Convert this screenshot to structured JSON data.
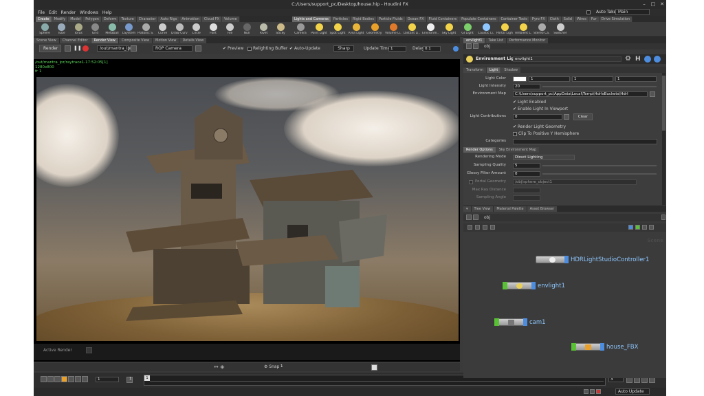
{
  "window": {
    "title": "C:/Users/support_pc/Desktop/house.hip - Houdini FX"
  },
  "menu": [
    "File",
    "Edit",
    "Render",
    "Windows",
    "Help"
  ],
  "takes": {
    "label": "Auto Takes",
    "desktop": "Main"
  },
  "shelf_tabs_left": [
    "Create",
    "Modify",
    "Model",
    "Polygon",
    "Deform",
    "Texture",
    "Character",
    "Auto Rigs",
    "Animation",
    "Cloud FX",
    "Volume"
  ],
  "shelf_tabs_right": [
    "Lights and Cameras",
    "Particles",
    "Rigid Bodies",
    "Particle Fluids",
    "Ocean FX",
    "Fluid Containers",
    "Populate Containers",
    "Container Tools",
    "Pyro FX",
    "Cloth",
    "Solid",
    "Wires",
    "Fur",
    "Drive Simulation"
  ],
  "tools_left": [
    "Sphere",
    "Tube",
    "Torus",
    "Grid",
    "Metaball",
    "LSystem",
    "Platonic S...",
    "Curve",
    "Draw Curve",
    "Circle",
    "Font",
    "File",
    "Null",
    "Rivet",
    "Sticky"
  ],
  "tools_right": [
    "Camera",
    "Point Light",
    "Spot Light",
    "Area Light",
    "Geometry ...",
    "Volume Li...",
    "Distant Li...",
    "Environm...",
    "Sky Light",
    "GI Light",
    "Caustic Li...",
    "Portal Light",
    "Ambient L...",
    "Stereo Ca...",
    "Switcher"
  ],
  "left_panel_tabs": [
    "Scene View",
    "Channel Editor",
    "Render View",
    "Composite View",
    "Motion View",
    "Details View"
  ],
  "right_panel_tabs": [
    "envlight1",
    "Take List",
    "Performance Monitor"
  ],
  "render_toolbar": {
    "render_label": "Render",
    "output": "/out/mantra_ipr",
    "camera": "ROP Camera",
    "preview": "Preview",
    "relighting": "Relighting Buffer",
    "auto_update": "Auto-Update",
    "sharp": "Sharp",
    "update_time_label": "Update Time",
    "update_time": "1",
    "delay_label": "Delay",
    "delay": "0.1"
  },
  "viewport": {
    "info": [
      "/out/mantra_ipr/raytrace1-17:52:05[1]",
      "1280x800",
      "fr 1"
    ],
    "active_render": "Active Render"
  },
  "snap": {
    "label": "Snap",
    "value": "1"
  },
  "timeline": {
    "frame": "1",
    "start": "1",
    "marker": "1",
    "end": "3"
  },
  "status": {
    "auto_update": "Auto Update"
  },
  "param": {
    "path": "obj",
    "type_label": "Environment Light",
    "node_name": "envlight1",
    "tabs": [
      "Transform",
      "Light",
      "Shadow"
    ],
    "light_color_label": "Light Color",
    "light_color": [
      "1",
      "1",
      "1"
    ],
    "intensity_label": "Light Intensity",
    "intensity": "20",
    "env_map_label": "Environment Map",
    "env_map": "C:\\Users\\support_pc\\AppData\\Local\\Temp\\HdrlsBuckets\\Hdrl",
    "light_enabled": "Light Enabled",
    "enable_in_viewport": "Enable Light In Viewport",
    "contributions_label": "Light Contributions",
    "contributions": "0",
    "clear": "Clear",
    "render_geom": "Render Light Geometry",
    "clip": "Clip To Positive Y Hemisphere",
    "categories_label": "Categories",
    "subtabs": [
      "Render Options",
      "Sky Environment Map"
    ],
    "rendering_mode_label": "Rendering Mode",
    "rendering_mode": "Direct Lighting",
    "sampling_quality_label": "Sampling Quality",
    "sampling_quality": "5",
    "glossy_label": "Glossy Filter Amount",
    "glossy": "0",
    "portal_label": "Portal Geometry",
    "portal": "/obj/sphere_object1",
    "max_ray_label": "Max Ray Distance",
    "sampling_angle_label": "Sampling Angle"
  },
  "network": {
    "tabs": [
      "Tree View",
      "Material Palette",
      "Asset Browser"
    ],
    "path": "obj",
    "context": "Scene",
    "nodes": [
      {
        "name": "HDRLightStudioController1"
      },
      {
        "name": "envlight1"
      },
      {
        "name": "cam1"
      },
      {
        "name": "house_FBX"
      }
    ]
  },
  "colors": {
    "bg": "#3a3a3a",
    "accent": "#8ec7ff",
    "node_green": "#59c234",
    "node_blue": "#4d8de0",
    "info": "#5cd65c"
  }
}
